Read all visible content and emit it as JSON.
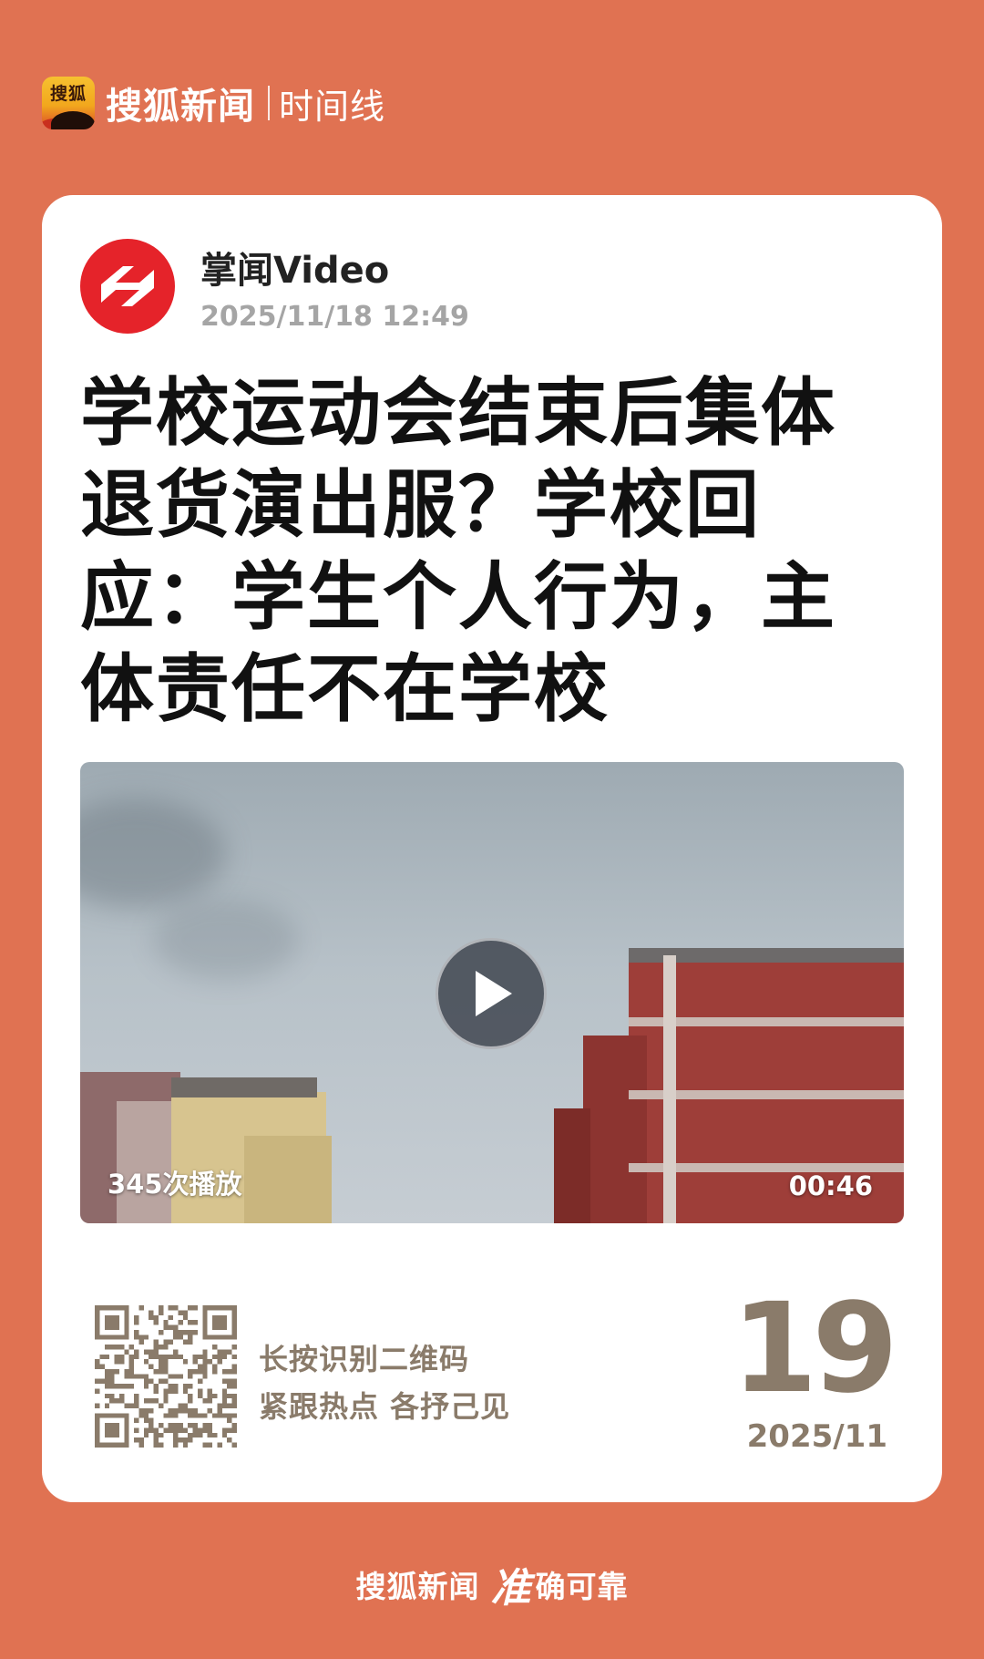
{
  "header": {
    "logo_text": "搜狐",
    "brand": "搜狐新闻",
    "section": "时间线"
  },
  "article": {
    "source_name": "掌闻Video",
    "publish_time": "2025/11/18 12:49",
    "title": "学校运动会结束后集体退货演出服？学校回应：学生个人行为，主体责任不在学校"
  },
  "video": {
    "views": "345次播放",
    "duration": "00:46"
  },
  "qr": {
    "line1": "长按识别二维码",
    "line2": "紧跟热点 各抒己见"
  },
  "date_stamp": {
    "day": "19",
    "year_month": "2025/11"
  },
  "footer": {
    "brand": "搜狐新闻",
    "zhun": "准",
    "slogan": "确可靠"
  },
  "colors": {
    "background": "#E07252",
    "card": "#FFFFFF",
    "avatar_red": "#E5232A",
    "muted_brown": "#8A7B6A"
  },
  "icons": {
    "logo": "sohu-fox-logo",
    "avatar": "zhangwen-logo-icon",
    "play": "play-icon",
    "qr": "qr-code-icon"
  }
}
